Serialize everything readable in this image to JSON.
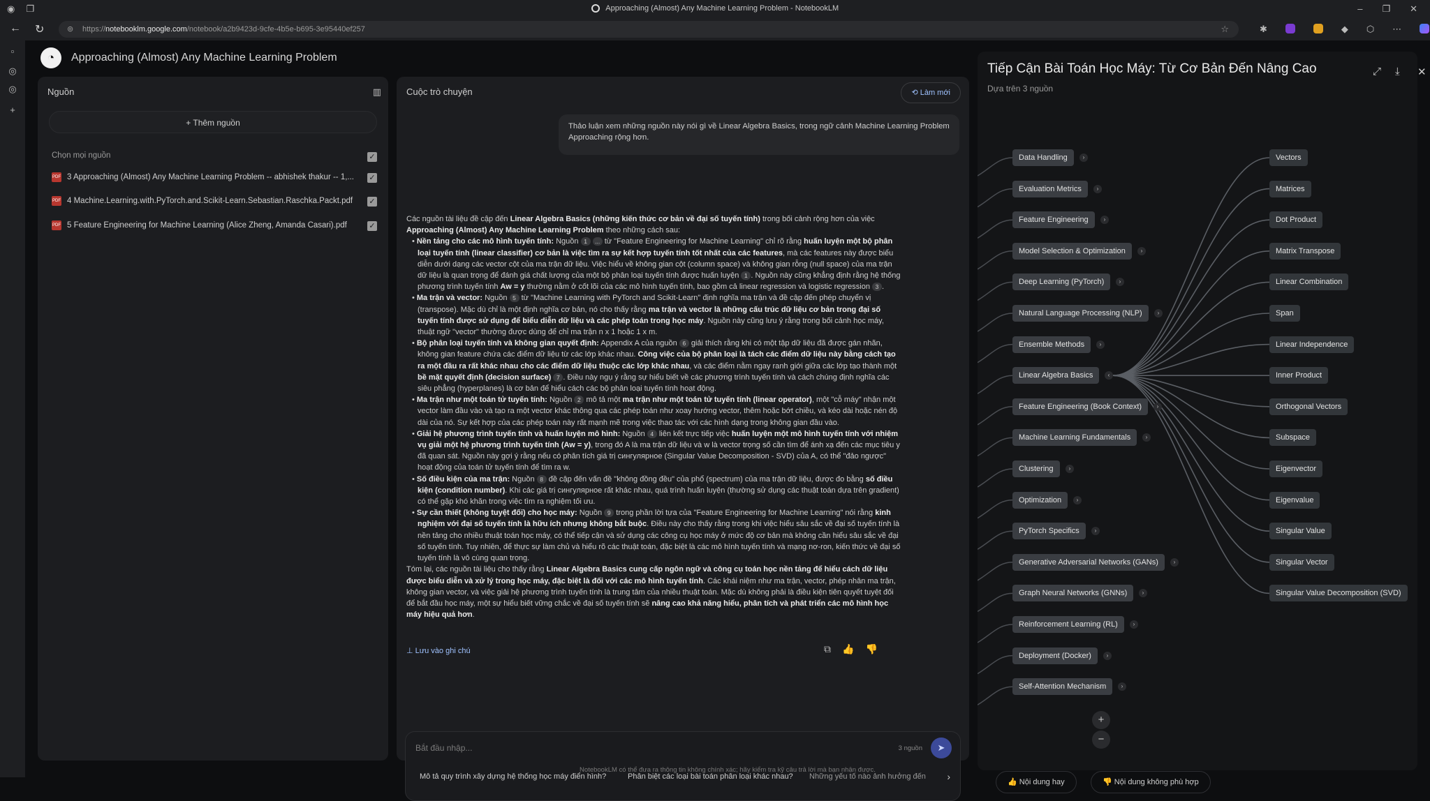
{
  "browser": {
    "window_title": "Approaching (Almost) Any Machine Learning Problem - NotebookLM",
    "url_host": "notebooklm.google.com",
    "url_prefix": "https://",
    "url_path": "/notebook/a2b9423d-9cfe-4b5e-b695-3e95440ef257"
  },
  "app": {
    "notebook_title": "Approaching (Almost) Any Machine Learning Problem",
    "footer_note": "NotebookLM có thể đưa ra thông tin không chính xác; hãy kiểm tra kỹ câu trả lời mà bạn nhận được."
  },
  "sources": {
    "header": "Nguồn",
    "add_button": "Thêm nguồn",
    "select_all": "Chọn mọi nguồn",
    "items": [
      "3 Approaching (Almost) Any Machine Learning Problem -- abhishek thakur -- 1,...",
      "4 Machine.Learning.with.PyTorch.and.Scikit-Learn.Sebastian.Raschka.Packt.pdf",
      "5 Feature Engineering for Machine Learning (Alice Zheng, Amanda Casari).pdf"
    ]
  },
  "chat": {
    "header": "Cuộc trò chuyện",
    "refresh_button": "Làm mới",
    "user_message": "Thảo luận xem những nguồn này nói gì về Linear Algebra Basics, trong ngữ cảnh Machine Learning Problem Approaching rộng hơn.",
    "save_note": "Lưu vào ghi chú",
    "input_placeholder": "Bắt đầu nhập...",
    "source_count": "3 nguồn",
    "suggestions": [
      "Mô tả quy trình xây dựng hệ thống học máy điển hình?",
      "Phân biệt các loại bài toán phân loại khác nhau?",
      "Những yếu tố nào ảnh hưởng đến"
    ],
    "answer": {
      "intro_a": "Các nguồn tài liệu đề cập đến ",
      "intro_b": "Linear Algebra Basics (những kiến thức cơ bản về đại số tuyến tính)",
      "intro_c": " trong bối cảnh rộng hơn của việc ",
      "intro_d": "Approaching (Almost) Any Machine Learning Problem",
      "intro_e": " theo những cách sau:",
      "b1_head": "Nền tảng cho các mô hình tuyến tính:",
      "b1_a": " Nguồn ",
      "b1_b": " từ \"Feature Engineering for Machine Learning\" chỉ rõ rằng ",
      "b1_c": "huấn luyện một bộ phân loại tuyến tính (linear classifier) cơ bản là việc tìm ra sự kết hợp tuyến tính tốt nhất của các features",
      "b1_d": ", mà các features này được biểu diễn dưới dạng các vector cột của ma trận dữ liệu. Việc hiểu về không gian cột (column space) và không gian rỗng (null space) của ma trận dữ liệu là quan trọng để đánh giá chất lượng của một bộ phân loại tuyến tính được huấn luyện ",
      "b1_e": ". Nguồn này cũng khẳng định rằng hệ thống phương trình tuyến tính ",
      "b1_f": "Aw = y",
      "b1_g": " thường nằm ở cốt lõi của các mô hình tuyến tính, bao gồm cả linear regression và logistic regression ",
      "b2_head": "Ma trận và vector:",
      "b2_a": " Nguồn ",
      "b2_b": " từ \"Machine Learning with PyTorch and Scikit-Learn\" định nghĩa ma trận và đề cập đến phép chuyển vị (transpose). Mặc dù chỉ là một định nghĩa cơ bản, nó cho thấy rằng ",
      "b2_c": "ma trận và vector là những cấu trúc dữ liệu cơ bản trong đại số tuyến tính được sử dụng để biểu diễn dữ liệu và các phép toán trong học máy",
      "b2_d": ". Nguồn này cũng lưu ý rằng trong bối cảnh học máy, thuật ngữ \"vector\" thường được dùng để chỉ ma trận n x 1 hoặc 1 x m.",
      "b3_head": "Bộ phân loại tuyến tính và không gian quyết định:",
      "b3_a": " Appendix A của nguồn ",
      "b3_b": " giải thích rằng khi có một tập dữ liệu đã được gán nhãn, không gian feature chứa các điểm dữ liệu từ các lớp khác nhau. ",
      "b3_c": "Công việc của bộ phân loại là tách các điểm dữ liệu này bằng cách tạo ra một đầu ra rất khác nhau cho các điểm dữ liệu thuộc các lớp khác nhau",
      "b3_d": ", và các điểm nằm ngay ranh giới giữa các lớp tạo thành một ",
      "b3_e": "bề mặt quyết định (decision surface)",
      "b3_f": ". Điều này ngụ ý rằng sự hiểu biết về các phương trình tuyến tính và cách chúng định nghĩa các siêu phẳng (hyperplanes) là cơ bản để hiểu cách các bộ phân loại tuyến tính hoạt động.",
      "b4_head": "Ma trận như một toán tử tuyến tính:",
      "b4_a": " Nguồn ",
      "b4_b": " mô tả một ",
      "b4_c": "ma trận như một toán tử tuyến tính (linear operator)",
      "b4_d": ", một \"cỗ máy\" nhận một vector làm đầu vào và tạo ra một vector khác thông qua các phép toán như xoay hướng vector, thêm hoặc bớt chiều, và kéo dài hoặc nén độ dài của nó. Sự kết hợp của các phép toán này rất mạnh mẽ trong việc thao tác với các hình dạng trong không gian đầu vào.",
      "b5_head": "Giải hệ phương trình tuyến tính và huấn luyện mô hình:",
      "b5_a": " Nguồn ",
      "b5_b": " liên kết trực tiếp việc ",
      "b5_c": "huấn luyện một mô hình tuyến tính với nhiệm vụ giải một hệ phương trình tuyến tính (Aw = y)",
      "b5_d": ", trong đó A là ma trận dữ liệu và w là vector trọng số cần tìm để ánh xạ đến các mục tiêu y đã quan sát. Nguồn này gợi ý rằng nếu có phân tích giá trị сингулярное (Singular Value Decomposition - SVD) của A, có thể \"đảo ngược\" hoạt động của toán tử tuyến tính để tìm ra w.",
      "b6_head": "Số điều kiện của ma trận:",
      "b6_a": " Nguồn ",
      "b6_b": " đề cập đến vấn đề \"không đồng đều\" của phổ (spectrum) của ma trận dữ liệu, được đo bằng ",
      "b6_c": "số điều kiện (condition number)",
      "b6_d": ". Khi các giá trị сингулярное rất khác nhau, quá trình huấn luyện (thường sử dụng các thuật toán dựa trên gradient) có thể gặp khó khăn trong việc tìm ra nghiệm tối ưu.",
      "b7_head": "Sự cần thiết (không tuyệt đối) cho học máy:",
      "b7_a": " Nguồn ",
      "b7_b": " trong phần lời tựa của \"Feature Engineering for Machine Learning\" nói rằng ",
      "b7_c": "kinh nghiệm với đại số tuyến tính là hữu ích nhưng không bắt buộc",
      "b7_d": ". Điều này cho thấy rằng trong khi việc hiểu sâu sắc về đại số tuyến tính là nền tảng cho nhiều thuật toán học máy, có thể tiếp cận và sử dụng các công cụ học máy ở mức độ cơ bản mà không cần hiểu sâu sắc về đại số tuyến tính. Tuy nhiên, để thực sự làm chủ và hiểu rõ các thuật toán, đặc biệt là các mô hình tuyến tính và mạng nơ-ron, kiến thức về đại số tuyến tính là vô cùng quan trọng.",
      "concl_a": "Tóm lại, các nguồn tài liệu cho thấy rằng ",
      "concl_b": "Linear Algebra Basics cung cấp ngôn ngữ và công cụ toán học nền tảng để hiểu cách dữ liệu được biểu diễn và xử lý trong học máy, đặc biệt là đối với các mô hình tuyến tính",
      "concl_c": ". Các khái niệm như ma trận, vector, phép nhân ma trận, không gian vector, và việc giải hệ phương trình tuyến tính là trung tâm của nhiều thuật toán. Mặc dù không phải là điều kiện tiên quyết tuyệt đối để bắt đầu học máy, một sự hiểu biết vững chắc về đại số tuyến tính sẽ ",
      "concl_d": "nâng cao khả năng hiểu, phân tích và phát triển các mô hình học máy hiệu quả hơn",
      "concl_e": ".",
      "cites": [
        "1",
        "...",
        "1",
        "3",
        "5",
        "6",
        "7",
        "2",
        "4",
        "8",
        "9"
      ]
    }
  },
  "mindmap": {
    "title": "Tiếp Cận Bài Toán Học Máy: Từ Cơ Bản Đến Nâng Cao",
    "subtitle": "Dựa trên 3 nguồn",
    "left_nodes": [
      "Data Handling",
      "Evaluation Metrics",
      "Feature Engineering",
      "Model Selection & Optimization",
      "Deep Learning (PyTorch)",
      "Natural Language Processing (NLP)",
      "Ensemble Methods",
      "Linear Algebra Basics",
      "Feature Engineering (Book Context)",
      "Machine Learning Fundamentals",
      "Clustering",
      "Optimization",
      "PyTorch Specifics",
      "Generative Adversarial Networks (GANs)",
      "Graph Neural Networks (GNNs)",
      "Reinforcement Learning (RL)",
      "Deployment (Docker)",
      "Self-Attention Mechanism"
    ],
    "right_nodes": [
      "Vectors",
      "Matrices",
      "Dot Product",
      "Matrix Transpose",
      "Linear Combination",
      "Span",
      "Linear Independence",
      "Inner Product",
      "Orthogonal Vectors",
      "Subspace",
      "Eigenvector",
      "Eigenvalue",
      "Singular Value",
      "Singular Vector",
      "Singular Value Decomposition (SVD)"
    ],
    "good_button": "Nội dung hay",
    "bad_button": "Nội dung không phù hợp"
  },
  "colors": {
    "accent": "#9fc2ff",
    "node_bg": "#3a3d42",
    "panel_bg": "#1c1d20"
  }
}
